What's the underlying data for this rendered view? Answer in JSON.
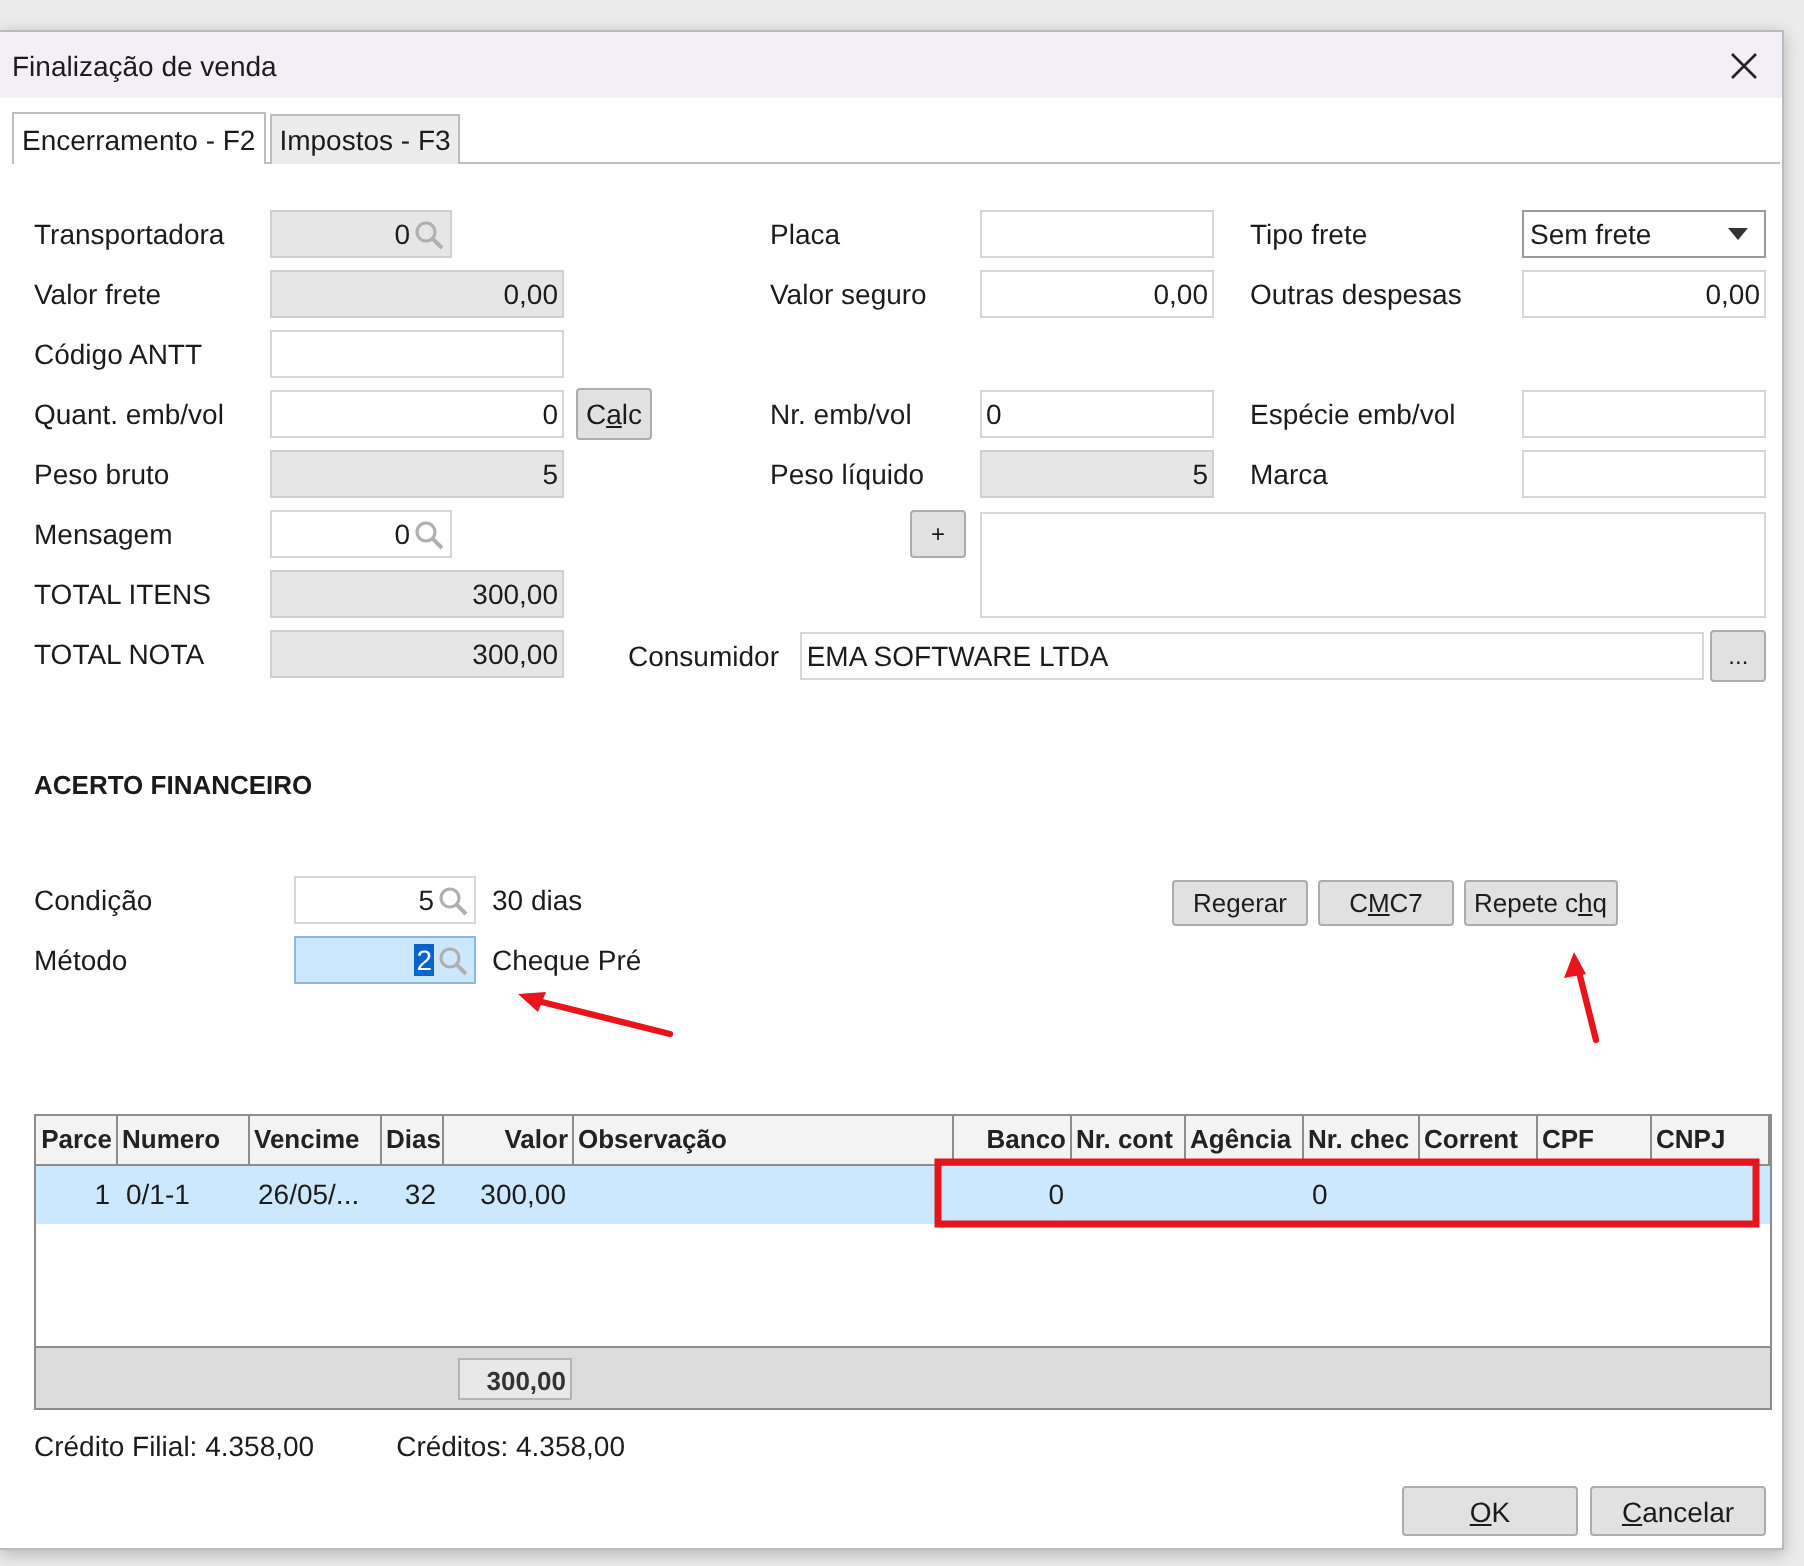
{
  "window": {
    "title": "Finalização de venda"
  },
  "tabs": [
    {
      "label": "Encerramento - F2",
      "selected": true
    },
    {
      "label": "Impostos - F3",
      "selected": false
    }
  ],
  "form": {
    "rows": [
      {
        "left": {
          "label": "Transportadora",
          "kind": "lookup",
          "value": "0",
          "disabled": true
        },
        "middle": {
          "label": "Placa",
          "kind": "text",
          "disabled": false
        },
        "right": {
          "label": "Tipo frete",
          "kind": "select",
          "value": "Sem frete",
          "disabled": false
        }
      },
      {
        "left": {
          "label": "Valor frete",
          "kind": "number",
          "value": "0,00",
          "disabled": true
        },
        "middle": {
          "label": "Valor seguro",
          "kind": "number",
          "value": "0,00",
          "disabled": false
        },
        "right": {
          "label": "Outras despesas",
          "kind": "number",
          "value": "0,00",
          "disabled": false
        }
      },
      {
        "left": {
          "label": "Código ANTT",
          "kind": "text",
          "disabled": false
        }
      },
      {
        "left": {
          "label": "Quant. emb/vol",
          "kind": "number",
          "value": "0",
          "disabled": false
        },
        "button": {
          "before": "C",
          "key": "a",
          "after": "lc"
        },
        "middle": {
          "label": "Nr. emb/vol",
          "kind": "text",
          "value": "0",
          "disabled": false
        },
        "right": {
          "label": "Espécie emb/vol",
          "kind": "text",
          "disabled": false
        }
      },
      {
        "left": {
          "label": "Peso bruto",
          "kind": "number",
          "value": "5",
          "disabled": true
        },
        "middle": {
          "label": "Peso líquido",
          "kind": "number",
          "value": "5",
          "disabled": true
        },
        "right": {
          "label": "Marca",
          "kind": "text",
          "disabled": false
        }
      },
      {
        "left": {
          "label": "Mensagem",
          "kind": "lookup",
          "value": "0",
          "disabled": false
        },
        "add_button": {
          "label": "+"
        }
      },
      {
        "left": {
          "label": "TOTAL ITENS",
          "kind": "number",
          "value": "300,00",
          "disabled": true
        }
      },
      {
        "left": {
          "label": "TOTAL NOTA",
          "kind": "number",
          "value": "300,00",
          "disabled": true
        },
        "consumer": {
          "label": "Consumidor",
          "value": "EMA SOFTWARE LTDA",
          "button": "..."
        }
      }
    ]
  },
  "finance": {
    "heading": "ACERTO FINANCEIRO",
    "fields": [
      {
        "label": "Condição",
        "value": "5",
        "description": "30 dias",
        "focused": false
      },
      {
        "label": "Método",
        "value": "2",
        "description": "Cheque Pré",
        "focused": true
      }
    ],
    "buttons": [
      {
        "before": "Regerar"
      },
      {
        "before": "C",
        "key": "M",
        "after": "C7"
      },
      {
        "before": "Repete c",
        "key": "h",
        "after": "q"
      }
    ]
  },
  "table": {
    "columns": [
      "Parce",
      "Numero",
      "Vencime",
      "Dias",
      "Valor",
      "Observação",
      "Banco",
      "Nr. cont",
      "Agência",
      "Nr. chec",
      "Corrent",
      "CPF",
      "CNPJ"
    ],
    "rows": [
      {
        "selected": true,
        "cells": [
          "1",
          "0/1-1",
          "26/05/...",
          "32",
          "300,00",
          null,
          "0",
          null,
          null,
          "0",
          null,
          null,
          null
        ]
      }
    ],
    "footer_total": "300,00"
  },
  "credits": [
    "Crédito Filial: 4.358,00",
    "Créditos: 4.358,00"
  ],
  "buttons": [
    {
      "key": "O",
      "after": "K"
    },
    {
      "key": "C",
      "after": "ancelar"
    }
  ]
}
